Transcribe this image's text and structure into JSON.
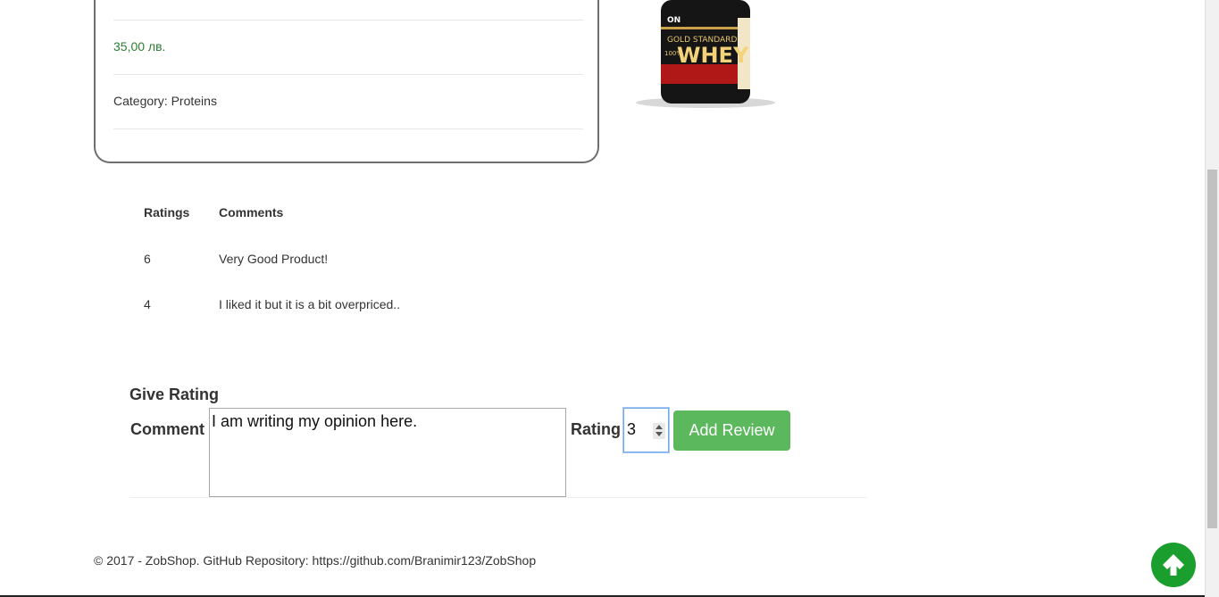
{
  "product": {
    "price": "35,00 лв.",
    "category_label": "Category:",
    "category_value": "Proteins",
    "image": {
      "brand_badge": "ON",
      "line1": "GOLD STANDARD",
      "line2": "100%",
      "line3": "WHEY"
    }
  },
  "reviews": {
    "headers": {
      "ratings": "Ratings",
      "comments": "Comments"
    },
    "rows": [
      {
        "rating": "6",
        "comment": "Very Good Product!"
      },
      {
        "rating": "4",
        "comment": "I liked it but it is a bit overpriced.."
      }
    ]
  },
  "form": {
    "title": "Give Rating",
    "comment_label": "Comment",
    "comment_value": "I am writing my opinion here.",
    "rating_label": "Rating",
    "rating_value": "3",
    "submit_label": "Add Review"
  },
  "footer": {
    "text": "© 2017 - ZobShop. GitHub Repository: https://github.com/Branimir123/ZobShop"
  },
  "colors": {
    "price": "#2e7d32",
    "button": "#5cb85c",
    "scroll_top": "#1a9e2e"
  },
  "icons": {
    "scroll_top": "arrow-up-icon"
  }
}
